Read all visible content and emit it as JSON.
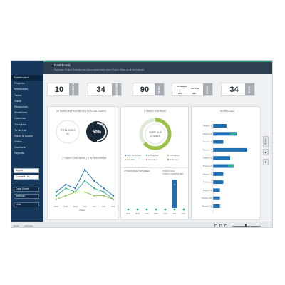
{
  "header": {
    "title": "Dashboard",
    "subtitle": "High level Project Overview that gives instant view of the Project Status at all the intervals"
  },
  "sidebar": {
    "items": [
      "Dashboard",
      "Projects",
      "Milestones",
      "Tasks",
      "Gantt",
      "Resources",
      "Workflows",
      "Calendar",
      "Timelines",
      "To do List",
      "Risks & Issues",
      "Notes",
      "Contacts",
      "Reports"
    ],
    "active_index": 0,
    "buttons_top": [
      "Import",
      "Connect Us"
    ],
    "buttons_bottom": [
      "Data Sheet",
      "Settings",
      "Lists"
    ]
  },
  "kpis": [
    {
      "value": "10",
      "label": "PROJECTS"
    },
    {
      "value": "34",
      "label": "MILESTONES"
    },
    {
      "value": "90",
      "label": "TASKS"
    },
    {
      "value": "34",
      "label": "RISKS"
    }
  ],
  "hours": {
    "planned_label": "PLANNED",
    "planned_value": "220",
    "actual_label": "ACTUAL",
    "actual_value": "205",
    "label": "HOURS"
  },
  "progress_panel": {
    "title": "10 TASKS IN PROGRESS | 20 TOTAL TASKS",
    "donut_label_line1": "TOTAL TASKS",
    "donut_label_line2": "90",
    "percent": "50%",
    "percent_value": 50,
    "trend_title": "7 TASKS THIS WEEK | 5 IN PROGRESS",
    "days": [
      "MON",
      "TUE",
      "WED",
      "THU",
      "FRI",
      "SAT",
      "SUN"
    ],
    "week_label": "WEEK",
    "legend": [
      "TASKS DUE",
      "TASKS COMPLETED",
      "TASKS IN PROGRESS"
    ]
  },
  "overdue_panel": {
    "title": "2 TASKS OVERDUE",
    "ring_line1": "OVER DUE",
    "ring_line2": "2 TASKS",
    "legend": [
      "Not - No to Start",
      "In Progress",
      "Completed",
      "On Hold",
      "Cancelled",
      "In Review"
    ],
    "week_title": "2 TASKS DUE THIS WEEK",
    "week_legend": [
      "TASKS DUE",
      "TASKS COMPLETED"
    ],
    "days": [
      "SUN",
      "MON",
      "TUE",
      "WED",
      "THU",
      "FRI",
      "SAT"
    ],
    "bar_value_label": "3"
  },
  "workload_panel": {
    "title": "WORKLOAD",
    "people": [
      "Person 1",
      "Person 2",
      "Person 3",
      "Person 4",
      "Person 5",
      "Person 6",
      "Person 7",
      "Person 8",
      "Person 9",
      "Person 10",
      "Person 11"
    ],
    "legend": [
      "TOTAL TASKS ASSIGNED",
      "DUE THIS WEEK"
    ]
  },
  "right_controls": {
    "view_label": "Board",
    "up": "▲",
    "down": "▼"
  },
  "statusbar": {
    "left": "Ready",
    "right": "Calculate"
  },
  "colors": {
    "navy": "#17385a",
    "header": "#2e3f4f",
    "accent": "#2ea37a",
    "blue": "#1e6fb3",
    "teal": "#27b08b"
  },
  "chart_data": [
    {
      "type": "line",
      "categories": [
        "MON",
        "TUE",
        "WED",
        "THU",
        "FRI",
        "SAT",
        "SUN"
      ],
      "series": [
        {
          "name": "TASKS DUE",
          "values": [
            3,
            5,
            4,
            9,
            6,
            4,
            2
          ]
        },
        {
          "name": "TASKS COMPLETED",
          "values": [
            2,
            4,
            3,
            6,
            4,
            3,
            1
          ]
        },
        {
          "name": "TASKS IN PROGRESS",
          "values": [
            1,
            2,
            3,
            3,
            2,
            2,
            1
          ]
        }
      ]
    },
    {
      "type": "bar",
      "categories": [
        "SUN",
        "MON",
        "TUE",
        "WED",
        "THU",
        "FRI",
        "SAT"
      ],
      "series": [
        {
          "name": "TASKS DUE",
          "values": [
            0,
            0,
            0,
            0,
            0,
            3,
            0
          ]
        },
        {
          "name": "TASKS COMPLETED",
          "values": [
            0,
            0,
            0,
            0,
            0,
            0,
            0
          ]
        }
      ]
    },
    {
      "type": "bar",
      "categories": [
        "Person 1",
        "Person 2",
        "Person 3",
        "Person 4",
        "Person 5",
        "Person 6",
        "Person 7",
        "Person 8",
        "Person 9",
        "Person 10",
        "Person 11"
      ],
      "series": [
        {
          "name": "TOTAL TASKS ASSIGNED",
          "values": [
            4,
            7,
            3,
            10,
            5,
            6,
            3,
            3,
            2,
            2,
            2
          ]
        },
        {
          "name": "DUE THIS WEEK",
          "values": [
            0,
            2,
            0,
            0,
            0,
            3,
            0,
            0,
            0,
            0,
            0
          ]
        }
      ]
    }
  ]
}
